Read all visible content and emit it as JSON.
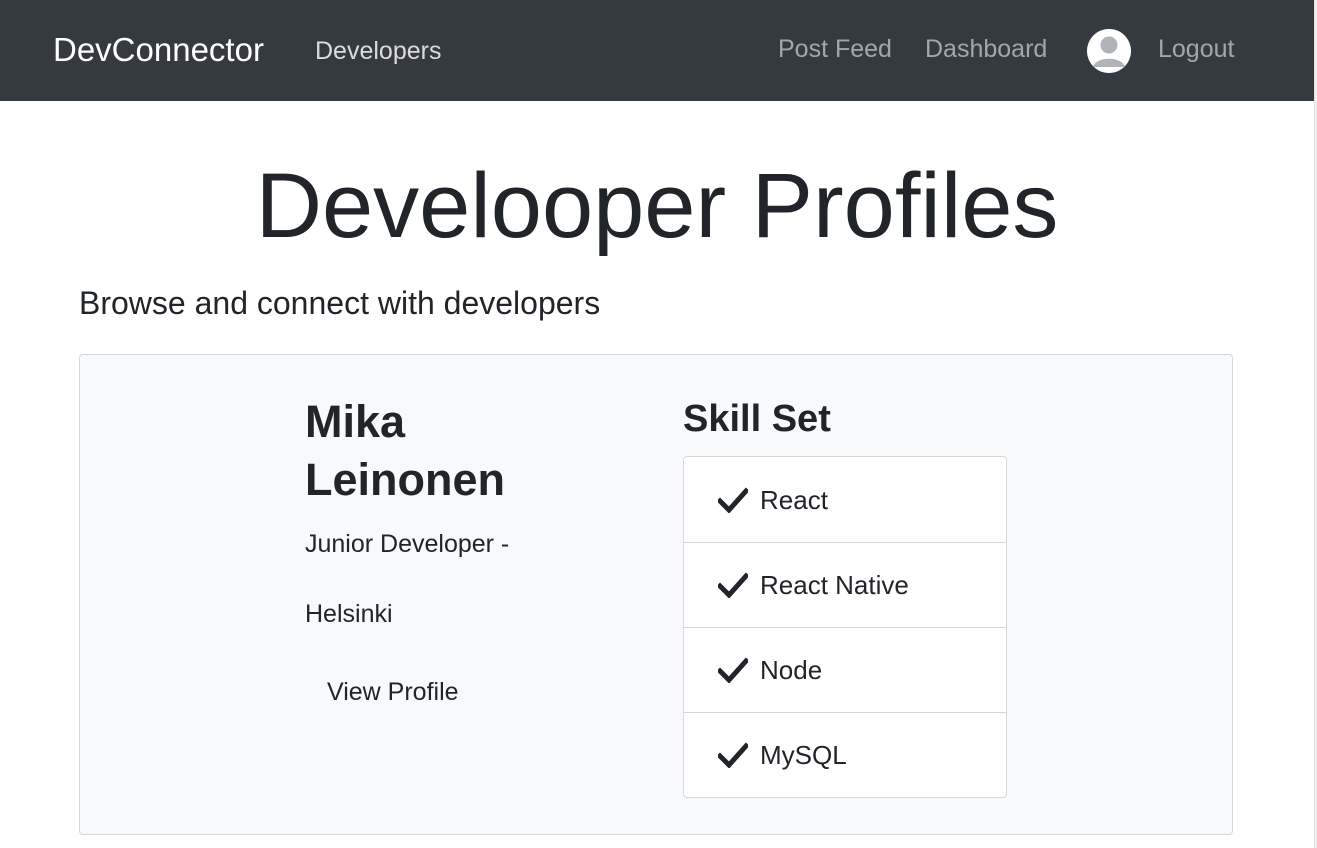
{
  "navbar": {
    "brand": "DevConnector",
    "left_links": [
      {
        "label": "Developers"
      }
    ],
    "right_links": {
      "post_feed": "Post Feed",
      "dashboard": "Dashboard",
      "logout": "Logout"
    },
    "avatar_icon": "user-avatar-icon",
    "background_color": "#343a40"
  },
  "header": {
    "title": "Develooper Profiles",
    "lead": "Browse and connect with developers"
  },
  "profiles": [
    {
      "name": "Mika Leinonen",
      "status": "Junior Developer -",
      "location": "Helsinki",
      "view_profile_label": "View Profile",
      "skills_title": "Skill Set",
      "skills": [
        {
          "label": "React",
          "icon": "check-icon"
        },
        {
          "label": "React Native",
          "icon": "check-icon"
        },
        {
          "label": "Node",
          "icon": "check-icon"
        },
        {
          "label": "MySQL",
          "icon": "check-icon"
        }
      ]
    }
  ]
}
